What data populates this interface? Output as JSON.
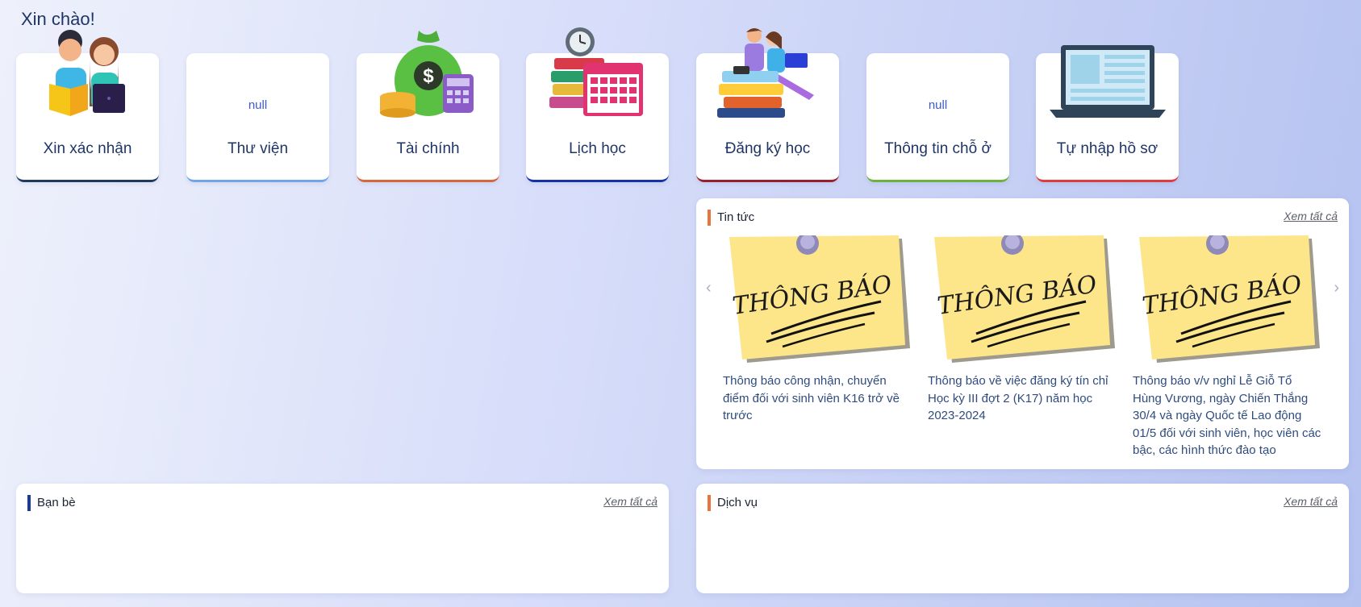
{
  "greeting": "Xin chào!",
  "tiles": [
    {
      "label": "Xin xác nhận",
      "accent": "#1e3a5f",
      "icon": "reading-couple-icon"
    },
    {
      "label": "Thư viện",
      "accent": "#6fa6ea",
      "icon": "broken-image-icon",
      "img_alt": "null"
    },
    {
      "label": "Tài chính",
      "accent": "#d9663a",
      "icon": "money-bag-icon"
    },
    {
      "label": "Lịch học",
      "accent": "#1433a8",
      "icon": "calendar-books-icon"
    },
    {
      "label": "Đăng ký học",
      "accent": "#9a1f2a",
      "icon": "students-laptop-icon"
    },
    {
      "label": "Thông tin chỗ ở",
      "accent": "#6bb33a",
      "icon": "broken-image-icon",
      "img_alt": "null"
    },
    {
      "label": "Tự nhập hồ sơ",
      "accent": "#e23b3b",
      "icon": "laptop-icon"
    }
  ],
  "news": {
    "title": "Tin tức",
    "see_all": "Xem tất cả",
    "note_text": "THÔNG BÁO",
    "items": [
      {
        "text": "Thông báo công nhận, chuyển điểm đối với sinh viên K16 trở về trước"
      },
      {
        "text": "Thông báo về việc đăng ký tín chỉ Học kỳ III đợt 2 (K17) năm học 2023-2024"
      },
      {
        "text": "Thông báo v/v nghỉ Lễ Giỗ Tổ Hùng Vương, ngày Chiến Thắng 30/4 và ngày Quốc tế Lao động 01/5 đối với sinh viên, học viên các bậc, các hình thức đào tạo"
      }
    ],
    "prev": "‹",
    "next": "›"
  },
  "friends": {
    "title": "Bạn bè",
    "see_all": "Xem tất cả",
    "accent": "#1e3a8a"
  },
  "services": {
    "title": "Dịch vụ",
    "see_all": "Xem tất cả",
    "accent": "#e8743b"
  }
}
